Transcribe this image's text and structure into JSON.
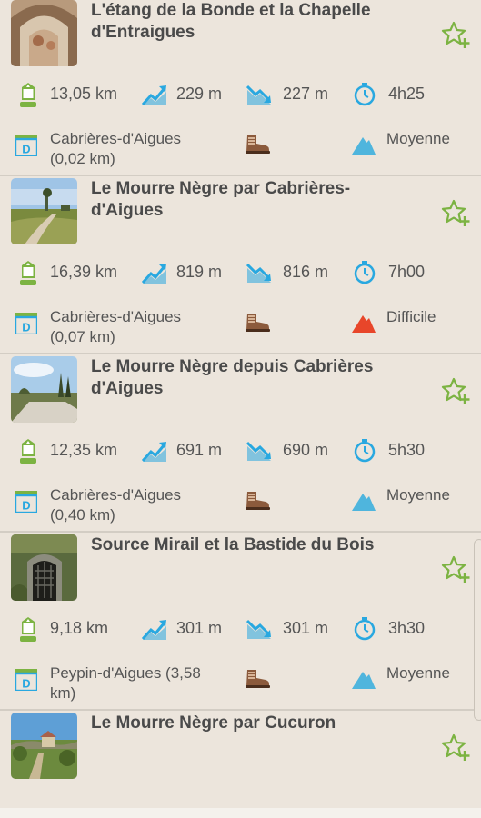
{
  "colors": {
    "background": "#ece5dc",
    "accent_green": "#7cb342",
    "accent_blue": "#29a8e0",
    "difficulty_medium": "#4fb5dd",
    "difficulty_hard": "#e8462a"
  },
  "icons": {
    "distance": "distance-marker-icon",
    "ascent": "ascent-icon",
    "descent": "descent-icon",
    "duration": "stopwatch-icon",
    "departure": "departure-sign-icon",
    "practice": "hiking-boot-icon",
    "difficulty": "mountain-icon",
    "favorite": "star-plus-icon"
  },
  "hikes": [
    {
      "title": "L'étang de la Bonde et la Chapelle d'Entraigues",
      "distance": "13,05 km",
      "ascent": "229 m",
      "descent": "227 m",
      "duration": "4h25",
      "departure": "Cabrières-d'Aigues (0,02 km)",
      "difficulty": "Moyenne",
      "difficulty_level": "medium"
    },
    {
      "title": "Le Mourre Nègre par Cabrières-d'Aigues",
      "distance": "16,39 km",
      "ascent": "819 m",
      "descent": "816 m",
      "duration": "7h00",
      "departure": "Cabrières-d'Aigues (0,07 km)",
      "difficulty": "Difficile",
      "difficulty_level": "hard"
    },
    {
      "title": "Le Mourre Nègre depuis Cabrières d'Aigues",
      "distance": "12,35 km",
      "ascent": "691 m",
      "descent": "690 m",
      "duration": "5h30",
      "departure": "Cabrières-d'Aigues (0,40 km)",
      "difficulty": "Moyenne",
      "difficulty_level": "medium"
    },
    {
      "title": "Source Mirail et la Bastide du Bois",
      "distance": "9,18 km",
      "ascent": "301 m",
      "descent": "301 m",
      "duration": "3h30",
      "departure": "Peypin-d'Aigues (3,58 km)",
      "difficulty": "Moyenne",
      "difficulty_level": "medium"
    },
    {
      "title": "Le Mourre Nègre par Cucuron"
    }
  ]
}
